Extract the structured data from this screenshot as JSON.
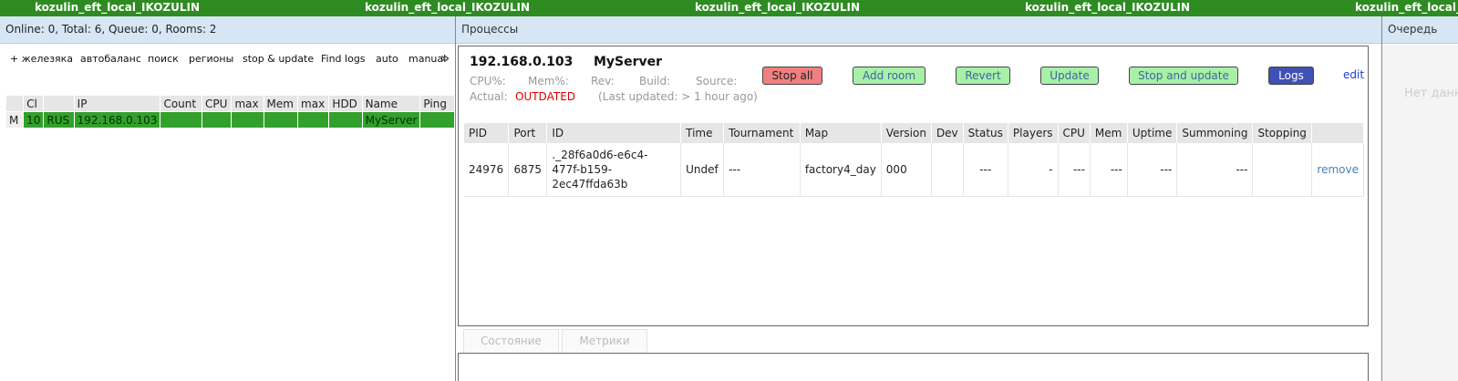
{
  "topbar": {
    "labels": [
      "kozulin_eft_local_IKOZULIN",
      "kozulin_eft_local_IKOZULIN",
      "kozulin_eft_local_IKOZULIN",
      "kozulin_eft_local_IKOZULIN",
      "kozulin_eft_local_IKOZULIN"
    ]
  },
  "left": {
    "status": "Online: 0,   Total: 6,   Queue: 0,   Rooms: 2",
    "toolbar": [
      "+ железяка",
      "автобаланс",
      "поиск",
      "регионы",
      "stop & update",
      "Find logs",
      "auto",
      "manual"
    ],
    "more_icon": "»",
    "table": {
      "headers": [
        "",
        "Cl",
        "",
        "IP",
        "Count",
        "CPU",
        "max",
        "Mem",
        "max",
        "HDD",
        "Name",
        "Ping"
      ],
      "row": [
        "M",
        "10",
        "RUS",
        "192.168.0.103",
        "",
        "",
        "",
        "",
        "",
        "",
        "MyServer",
        ""
      ]
    }
  },
  "center": {
    "title": "Процессы",
    "server": {
      "ip": "192.168.0.103",
      "name": "MyServer",
      "cpu_label": "CPU%:",
      "mem_label": "Mem%:",
      "rev_label": "Rev:",
      "build_label": "Build:",
      "source_label": "Source:",
      "actual_label": "Actual:",
      "actual_value": "OUTDATED",
      "last_updated": "(Last updated: > 1 hour ago)"
    },
    "buttons": {
      "stop_all": "Stop all",
      "add_room": "Add room",
      "revert": "Revert",
      "update": "Update",
      "stop_and_update": "Stop and update",
      "logs": "Logs",
      "edit": "edit"
    },
    "processes": {
      "headers": [
        "PID",
        "Port",
        "ID",
        "Time",
        "Tournament",
        "Map",
        "Version",
        "Dev",
        "Status",
        "Players",
        "CPU",
        "Mem",
        "Uptime",
        "Summoning",
        "Stopping",
        ""
      ],
      "row": {
        "pid": "24976",
        "port": "6875",
        "id_line1": "._28f6a0d6-e6c4-",
        "id_line2": "477f-b159-",
        "id_line3": "2ec47ffda63b",
        "time": "Undef",
        "tournament": "---",
        "map": "factory4_day",
        "version": "000",
        "dev": "",
        "status": "---",
        "players": "-",
        "cpu": "---",
        "mem": "---",
        "uptime": "---",
        "summoning": "---",
        "stopping": "",
        "action": "remove"
      }
    },
    "tabs": [
      "Состояние",
      "Метрики"
    ]
  },
  "right": {
    "title": "Очередь",
    "empty": "Нет данных"
  },
  "colors": {
    "topbar": "#2e8b22",
    "header_bg": "#d7e6f5",
    "row_green": "#33a02c",
    "stop_red": "#f08080",
    "btn_green": "#a8f0a8",
    "logs_blue": "#3f51b5"
  }
}
